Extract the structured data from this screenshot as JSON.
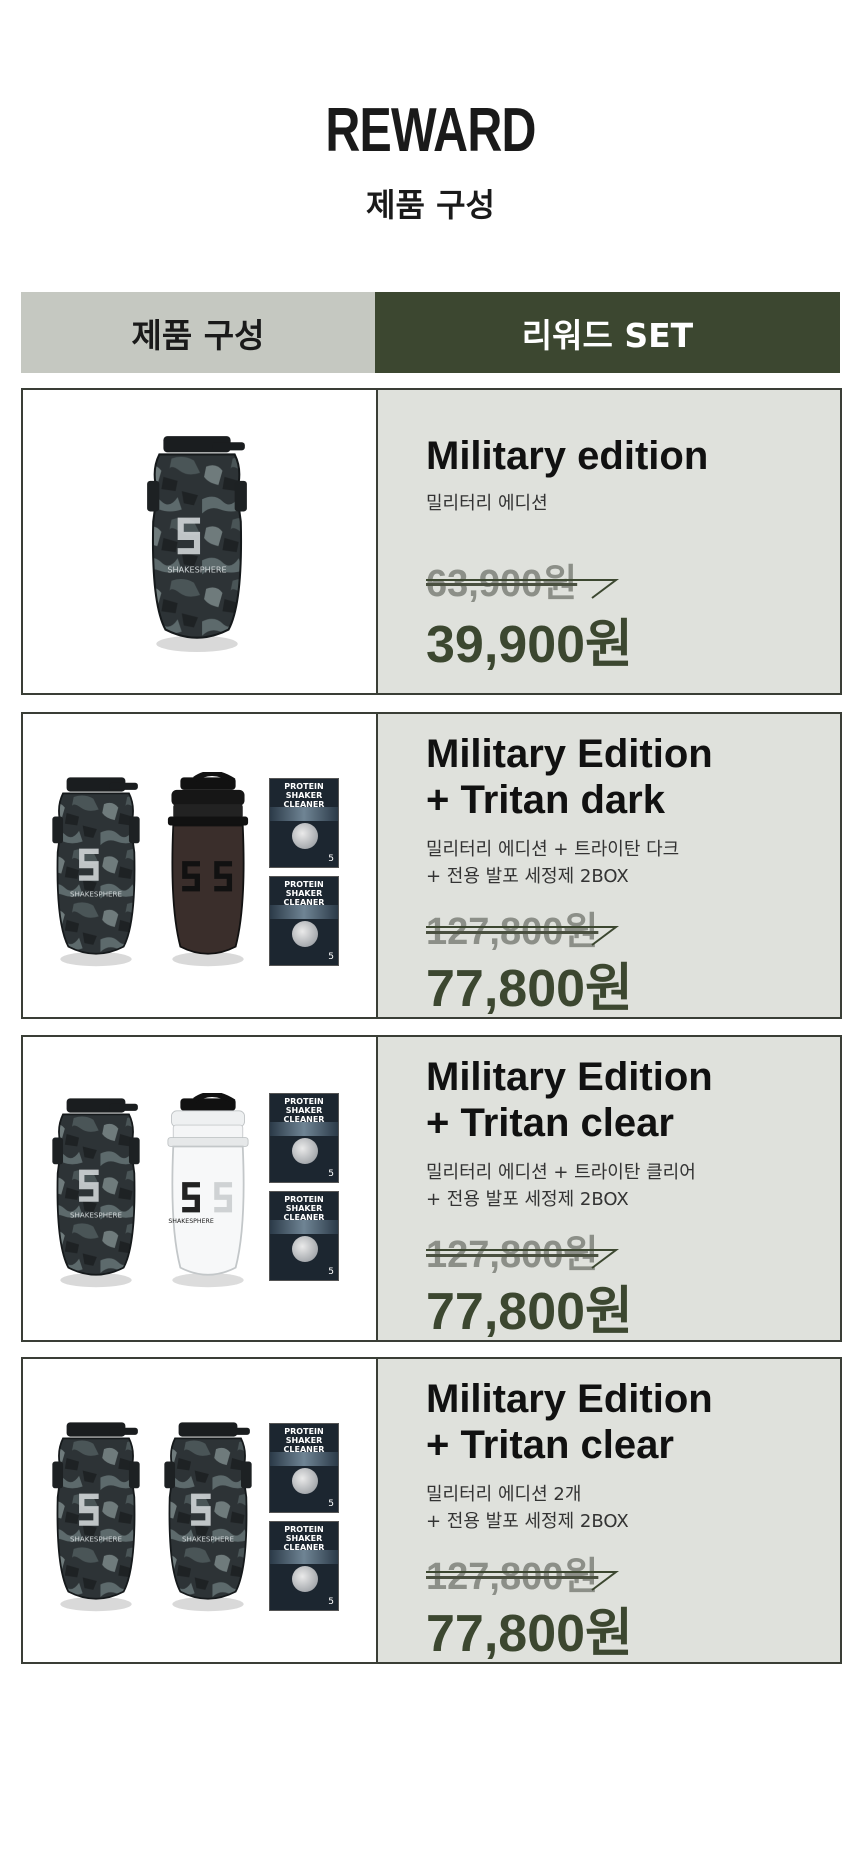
{
  "header": {
    "title": "REWARD",
    "subtitle": "제품 구성"
  },
  "table_header": {
    "left": "제품 구성",
    "right": "리워드 SET"
  },
  "box_label": "PROTEIN SHAKER CLEANER",
  "box_number": "5",
  "brand_text": "SHAKESPHERE",
  "colors": {
    "accent": "#3c4730",
    "header_gray": "#c5c8c1",
    "info_bg": "#dfe1dc",
    "old_price": "#8c8f88"
  },
  "rewards": [
    {
      "name": "Military edition",
      "desc": "밀리터리 에디션",
      "old_price": "63,900원",
      "new_price": "39,900원",
      "items": [
        "camo-bottle"
      ]
    },
    {
      "name_line1": "Military Edition",
      "name_line2": "+ Tritan dark",
      "desc_line1": "밀리터리 에디션 + 트라이탄 다크",
      "desc_line2": "+ 전용 발포 세정제 2BOX",
      "old_price": "127,800원",
      "new_price": "77,800원",
      "items": [
        "camo-bottle",
        "dark-tritan-bottle",
        "cleaner-box",
        "cleaner-box"
      ]
    },
    {
      "name_line1": "Military Edition",
      "name_line2": "+ Tritan clear",
      "desc_line1": "밀리터리 에디션 + 트라이탄 클리어",
      "desc_line2": "+ 전용 발포 세정제 2BOX",
      "old_price": "127,800원",
      "new_price": "77,800원",
      "items": [
        "camo-bottle",
        "clear-tritan-bottle",
        "cleaner-box",
        "cleaner-box"
      ]
    },
    {
      "name_line1": "Military Edition",
      "name_line2": "+ Tritan clear",
      "desc_line1": "밀리터리 에디션 2개",
      "desc_line2": "+ 전용 발포 세정제 2BOX",
      "old_price": "127,800원",
      "new_price": "77,800원",
      "items": [
        "camo-bottle",
        "camo-bottle",
        "cleaner-box",
        "cleaner-box"
      ]
    }
  ]
}
